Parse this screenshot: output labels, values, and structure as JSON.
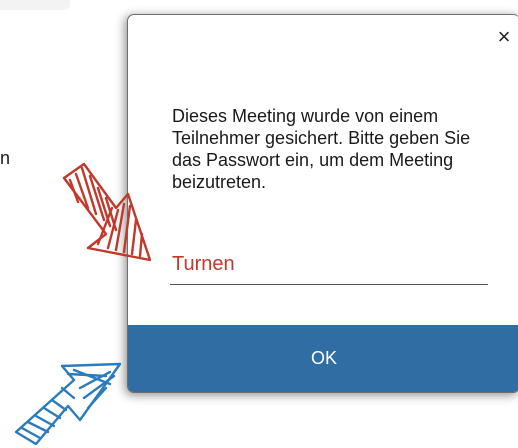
{
  "background": {
    "fragment_text": "n"
  },
  "dialog": {
    "close_glyph": "×",
    "message": "Dieses Meeting wurde von einem Teilnehmer gesichert. Bitte geben Sie das Passwort ein, um dem Meeting beizutreten.",
    "password_value": "Turnen",
    "ok_label": "OK"
  },
  "icons": {
    "close": "close-icon",
    "red_arrow": "red-hand-drawn-arrow",
    "blue_arrow": "blue-hand-drawn-arrow"
  },
  "colors": {
    "ok_button": "#2f6da2",
    "password_text": "#c0392b",
    "red_arrow": "#c0392b",
    "blue_arrow": "#2b7bbd"
  }
}
